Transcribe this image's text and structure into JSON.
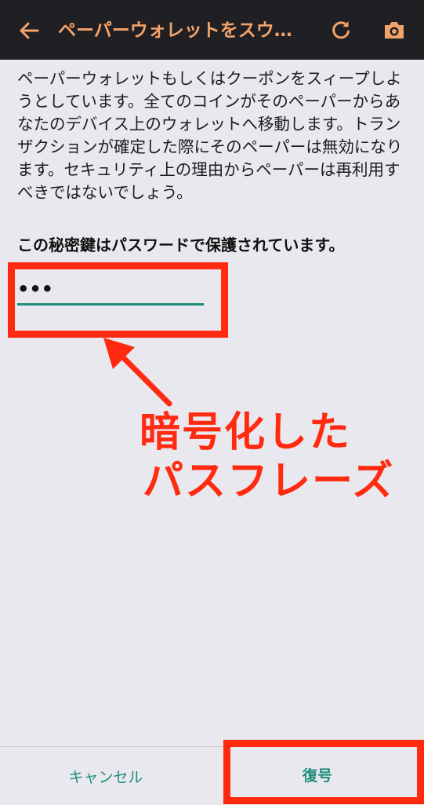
{
  "toolbar": {
    "title": "ペーパーウォレットをスウ…",
    "back_icon": "arrow-left-icon",
    "refresh_icon": "refresh-icon",
    "camera_icon": "camera-icon",
    "background": "#201f24",
    "title_color": "#f2a36a"
  },
  "content": {
    "description": "ペーパーウォレットもしくはクーポンをスィープしようとしています。全てのコインがそのペーパーからあなたのデバイス上のウォレットへ移動します。トランザクションが確定した際にそのペーパーは無効になります。セキュリティ上の理由からペーパーは再利用すべきではないでしょう。",
    "passphrase_prompt": "この秘密鍵はパスワードで保護されています。",
    "passphrase_value": "•••"
  },
  "annotation": {
    "line1": "暗号化した",
    "line2": "パスフレーズ",
    "color": "#ff2a0f"
  },
  "buttons": {
    "cancel": "キャンセル",
    "decrypt": "復号",
    "accent": "#1f8d7d"
  }
}
